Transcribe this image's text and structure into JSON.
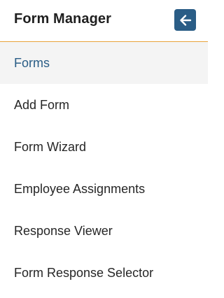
{
  "header": {
    "title": "Form Manager",
    "back_icon": "arrow-left-icon"
  },
  "menu": {
    "items": [
      {
        "label": "Forms",
        "active": true
      },
      {
        "label": "Add Form",
        "active": false
      },
      {
        "label": "Form Wizard",
        "active": false
      },
      {
        "label": "Employee Assignments",
        "active": false
      },
      {
        "label": "Response Viewer",
        "active": false
      },
      {
        "label": "Form Response Selector",
        "active": false
      }
    ]
  },
  "colors": {
    "accent": "#2a5d86",
    "divider": "#e8a33a",
    "active_bg": "#f4f4f4"
  }
}
